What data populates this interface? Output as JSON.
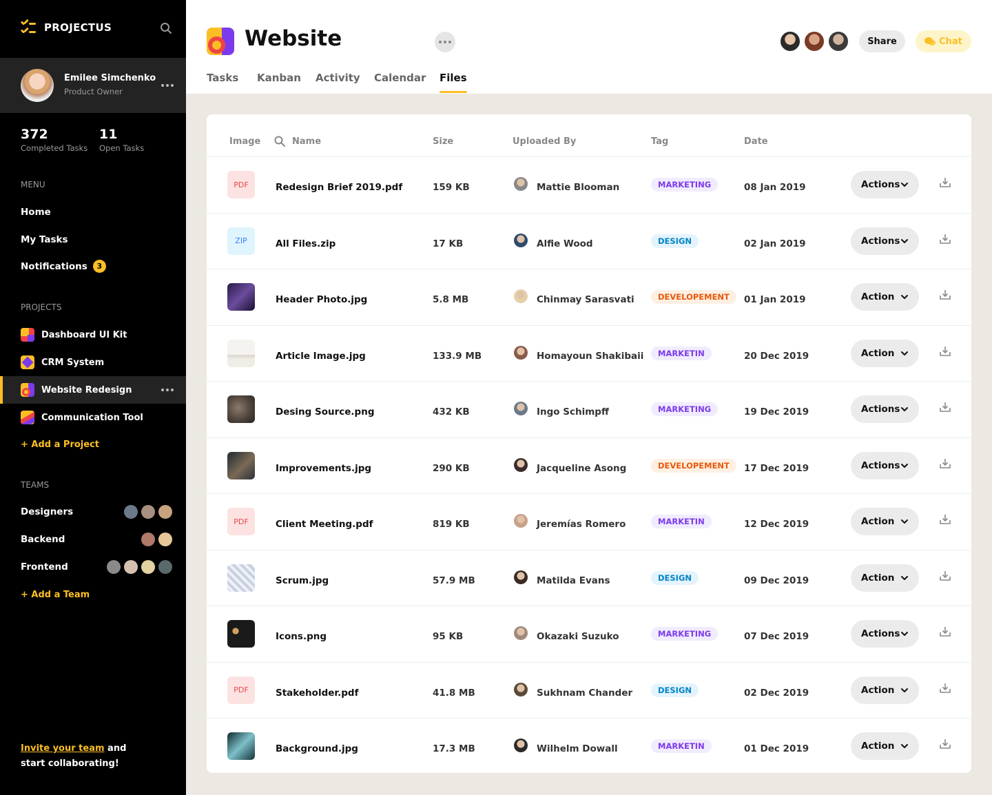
{
  "app": {
    "name": "PROJECTUS"
  },
  "user": {
    "name": "Emilee Simchenko",
    "role": "Product Owner"
  },
  "stats": [
    {
      "value": "372",
      "label": "Completed Tasks"
    },
    {
      "value": "11",
      "label": "Open Tasks"
    }
  ],
  "menu": {
    "label": "MENU",
    "items": [
      "Home",
      "My Tasks",
      "Notifications"
    ],
    "notifications_count": "3"
  },
  "projects": {
    "label": "PROJECTS",
    "items": [
      "Dashboard UI Kit",
      "CRM System",
      "Website Redesign",
      "Communication Tool"
    ],
    "active": "Website Redesign",
    "add_label": "+ Add a Project"
  },
  "teams": {
    "label": "TEAMS",
    "items": [
      "Designers",
      "Backend",
      "Frontend"
    ],
    "add_label": "+ Add a Team"
  },
  "invite": {
    "link": "Invite your team",
    "rest1": " and",
    "rest2": "start collaborating!"
  },
  "header": {
    "title": "Website",
    "tabs": [
      "Tasks",
      "Kanban",
      "Activity",
      "Calendar",
      "Files"
    ],
    "active_tab": "Files",
    "share_label": "Share",
    "chat_label": "Chat"
  },
  "colors": {
    "accent": "#fbbf24",
    "sidebar": "#000000"
  },
  "table": {
    "columns": [
      "Image",
      "Name",
      "Size",
      "Uploaded By",
      "Tag",
      "Date"
    ],
    "rows": [
      {
        "thumb": "PDF",
        "name": "Redesign Brief 2019.pdf",
        "size": "159 KB",
        "user": "Mattie Blooman",
        "tag": "MARKETING",
        "tag_type": "m",
        "date": "08 Jan 2019",
        "action": "Actions"
      },
      {
        "thumb": "ZIP",
        "name": "All Files.zip",
        "size": "17 KB",
        "user": "Alfie Wood",
        "tag": "DESIGN",
        "tag_type": "d",
        "date": "02 Jan 2019",
        "action": "Actions"
      },
      {
        "thumb": "img",
        "name": "Header Photo.jpg",
        "size": "5.8 MB",
        "user": "Chinmay Sarasvati",
        "tag": "DEVELOPEMENT",
        "tag_type": "v",
        "date": "01 Jan 2019",
        "action": "Action"
      },
      {
        "thumb": "img",
        "name": "Article Image.jpg",
        "size": "133.9 MB",
        "user": "Homayoun Shakibaii",
        "tag": "MARKETIN",
        "tag_type": "m",
        "date": "20 Dec 2019",
        "action": "Action"
      },
      {
        "thumb": "img",
        "name": "Desing Source.png",
        "size": "432 KB",
        "user": "Ingo Schimpff",
        "tag": "MARKETING",
        "tag_type": "m",
        "date": "19 Dec 2019",
        "action": "Actions"
      },
      {
        "thumb": "img",
        "name": "Improvements.jpg",
        "size": "290 KB",
        "user": "Jacqueline Asong",
        "tag": "DEVELOPEMENT",
        "tag_type": "v",
        "date": "17 Dec 2019",
        "action": "Actions"
      },
      {
        "thumb": "PDF",
        "name": "Client Meeting.pdf",
        "size": "819 KB",
        "user": "Jeremías Romero",
        "tag": "MARKETIN",
        "tag_type": "m",
        "date": "12 Dec 2019",
        "action": "Action"
      },
      {
        "thumb": "img",
        "name": "Scrum.jpg",
        "size": "57.9 MB",
        "user": "Matilda Evans",
        "tag": "DESIGN",
        "tag_type": "d",
        "date": "09 Dec 2019",
        "action": "Action"
      },
      {
        "thumb": "img",
        "name": "Icons.png",
        "size": "95 KB",
        "user": "Okazaki Suzuko",
        "tag": "MARKETING",
        "tag_type": "m",
        "date": "07 Dec 2019",
        "action": "Actions"
      },
      {
        "thumb": "PDF",
        "name": "Stakeholder.pdf",
        "size": "41.8 MB",
        "user": "Sukhnam Chander",
        "tag": "DESIGN",
        "tag_type": "d",
        "date": "02 Dec 2019",
        "action": "Action"
      },
      {
        "thumb": "img",
        "name": "Background.jpg",
        "size": "17.3 MB",
        "user": "Wilhelm Dowall",
        "tag": "MARKETIN",
        "tag_type": "m",
        "date": "01 Dec 2019",
        "action": "Action"
      }
    ]
  }
}
